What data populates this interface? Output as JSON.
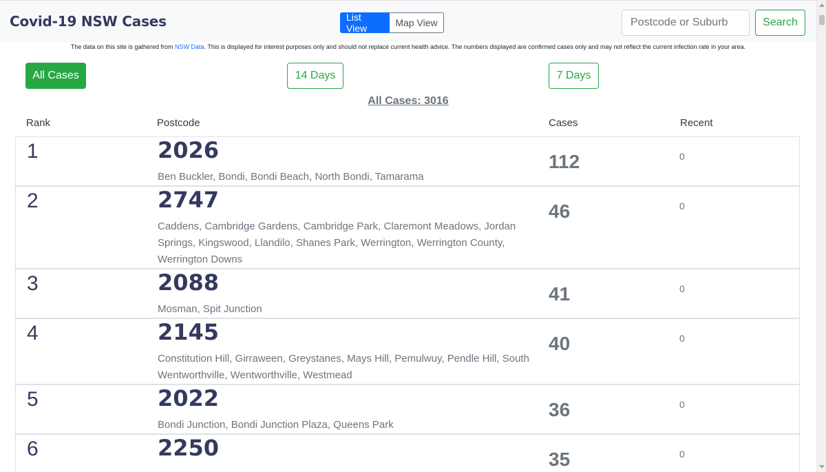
{
  "header": {
    "brand": "Covid-19 NSW Cases",
    "list_view": "List View",
    "map_view": "Map View",
    "search_placeholder": "Postcode or Suburb",
    "search_label": "Search"
  },
  "disclaimer": {
    "before": "The data on this site is gathered from ",
    "link": "NSW Data",
    "after": ". This is displayed for interest purposes only and should not replace current health advice. The numbers displayed are confirmed cases only and may not reflect the current infection rate in your area."
  },
  "filters": {
    "all_cases": "All Cases",
    "days14": "14 Days",
    "days7": "7 Days"
  },
  "summary": "All Cases: 3016",
  "columns": {
    "rank": "Rank",
    "postcode": "Postcode",
    "cases": "Cases",
    "recent": "Recent"
  },
  "rows": [
    {
      "rank": "1",
      "postcode": "2026",
      "suburbs": "Ben Buckler, Bondi, Bondi Beach, North Bondi, Tamarama",
      "cases": "112",
      "recent": "0"
    },
    {
      "rank": "2",
      "postcode": "2747",
      "suburbs": "Caddens, Cambridge Gardens, Cambridge Park, Claremont Meadows, Jordan Springs, Kingswood, Llandilo, Shanes Park, Werrington, Werrington County, Werrington Downs",
      "cases": "46",
      "recent": "0"
    },
    {
      "rank": "3",
      "postcode": "2088",
      "suburbs": "Mosman, Spit Junction",
      "cases": "41",
      "recent": "0"
    },
    {
      "rank": "4",
      "postcode": "2145",
      "suburbs": "Constitution Hill, Girraween, Greystanes, Mays Hill, Pemulwuy, Pendle Hill, South Wentworthville, Wentworthville, Westmead",
      "cases": "40",
      "recent": "0"
    },
    {
      "rank": "5",
      "postcode": "2022",
      "suburbs": "Bondi Junction, Bondi Junction Plaza, Queens Park",
      "cases": "36",
      "recent": "0"
    },
    {
      "rank": "6",
      "postcode": "2250",
      "suburbs": "",
      "cases": "35",
      "recent": "0"
    }
  ]
}
